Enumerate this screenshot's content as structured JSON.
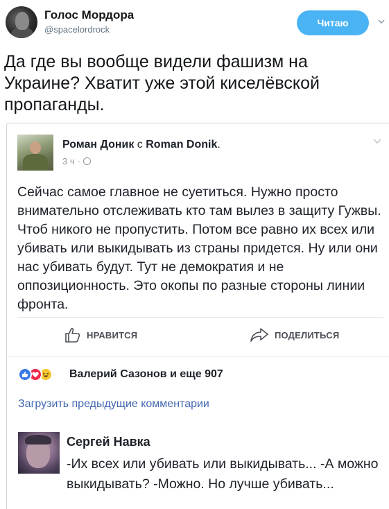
{
  "tweet": {
    "author_name": "Голос Мордора",
    "author_handle": "@spacelordrock",
    "follow_label": "Читаю",
    "text": "Да где вы вообще видели фашизм на Украине? Хватит уже этой киселёвской пропаганды."
  },
  "fb_post": {
    "author": "Роман Доник",
    "with_word": "с",
    "with_name": "Roman Donik",
    "with_suffix": ".",
    "time": "3 ч",
    "separator": "·",
    "body": "Сейчас самое главное не суетиться. Нужно просто внимательно отслеживать кто там вылез в защиту Гужвы. Чтоб никого не пропустить. Потом все равно их всех или убивать или выкидывать из страны придется. Ну или они нас убивать будут. Тут не демократия и не оппозиционность. Это окопы по разные стороны линии фронта.",
    "like_label": "НРАВИТСЯ",
    "share_label": "ПОДЕЛИТЬСЯ",
    "reactions_text": "Валерий Сазонов и еще 907",
    "load_prev_label": "Загрузить предыдущие комментарии",
    "comment": {
      "author": "Сергей Навка",
      "text": "-Их всех или убивать или выкидывать... -А можно выкидывать? -Можно. Но лучше убивать..."
    }
  },
  "icons": [
    "chevron-down-icon",
    "globe-icon",
    "thumbs-up-icon",
    "share-arrow-icon",
    "like-reaction-icon",
    "love-reaction-icon",
    "haha-reaction-icon"
  ],
  "colors": {
    "follow_button": "#4ab3f4",
    "link_blue": "#4267b2",
    "like_reaction": "#3b78e7",
    "love_reaction": "#f0284a",
    "haha_reaction": "#f7c531"
  }
}
